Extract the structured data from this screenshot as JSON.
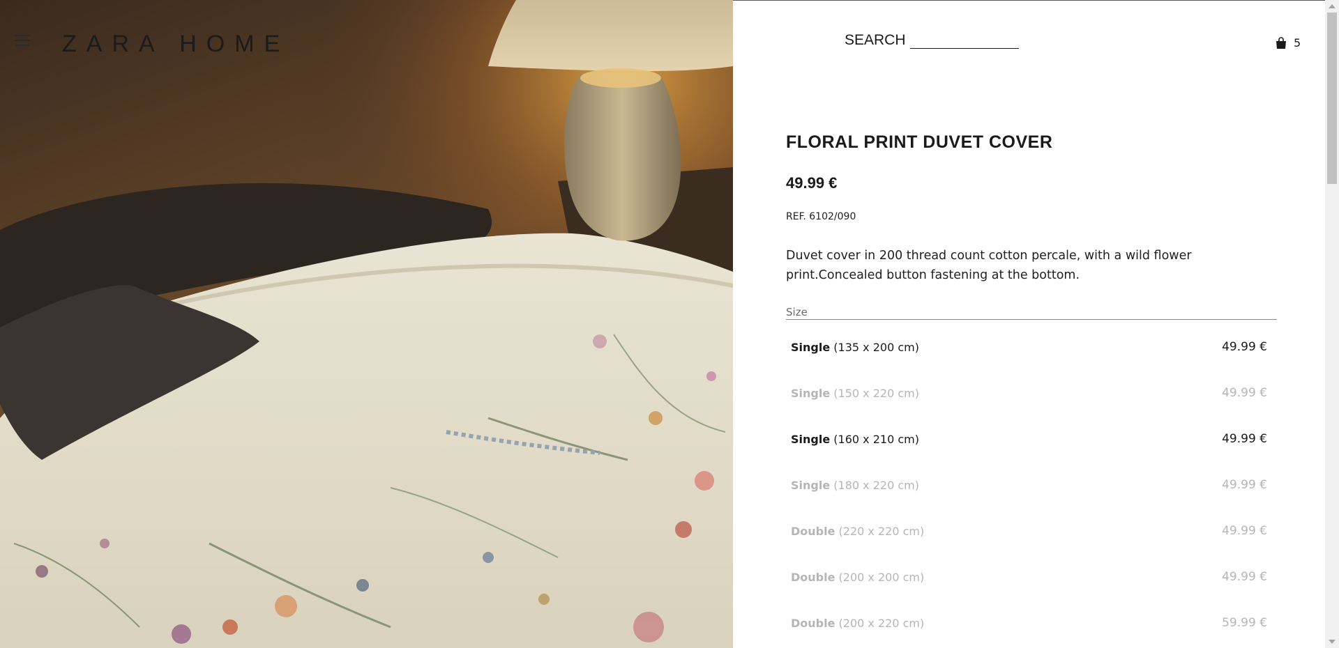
{
  "header": {
    "logo": "ZARA HOME",
    "menu_icon": "hamburger-menu-icon",
    "search_label": "SEARCH",
    "cart_icon": "shopping-bag-icon",
    "cart_count": "5"
  },
  "product": {
    "title": "FLORAL PRINT DUVET COVER",
    "price": "49.99 €",
    "ref": "REF. 6102/090",
    "description": "Duvet cover in 200 thread count cotton percale, with a wild flower print.Concealed button fastening at the bottom.",
    "size_label": "Size",
    "sizes": [
      {
        "name": "Single",
        "dims": "(135 x 200 cm)",
        "price": "49.99 €",
        "available": true
      },
      {
        "name": "Single",
        "dims": "(150 x 220 cm)",
        "price": "49.99 €",
        "available": false
      },
      {
        "name": "Single",
        "dims": "(160 x 210 cm)",
        "price": "49.99 €",
        "available": true
      },
      {
        "name": "Single",
        "dims": "(180 x 220 cm)",
        "price": "49.99 €",
        "available": false
      },
      {
        "name": "Double",
        "dims": "(220 x 220 cm)",
        "price": "49.99 €",
        "available": false
      },
      {
        "name": "Double",
        "dims": "(200 x 200 cm)",
        "price": "49.99 €",
        "available": false
      },
      {
        "name": "Double",
        "dims": "(200 x 220 cm)",
        "price": "59.99 €",
        "available": false
      }
    ]
  },
  "colors": {
    "text": "#1a1a1a",
    "unavailable": "#b5b5b5",
    "divider": "#8a8a8a"
  }
}
